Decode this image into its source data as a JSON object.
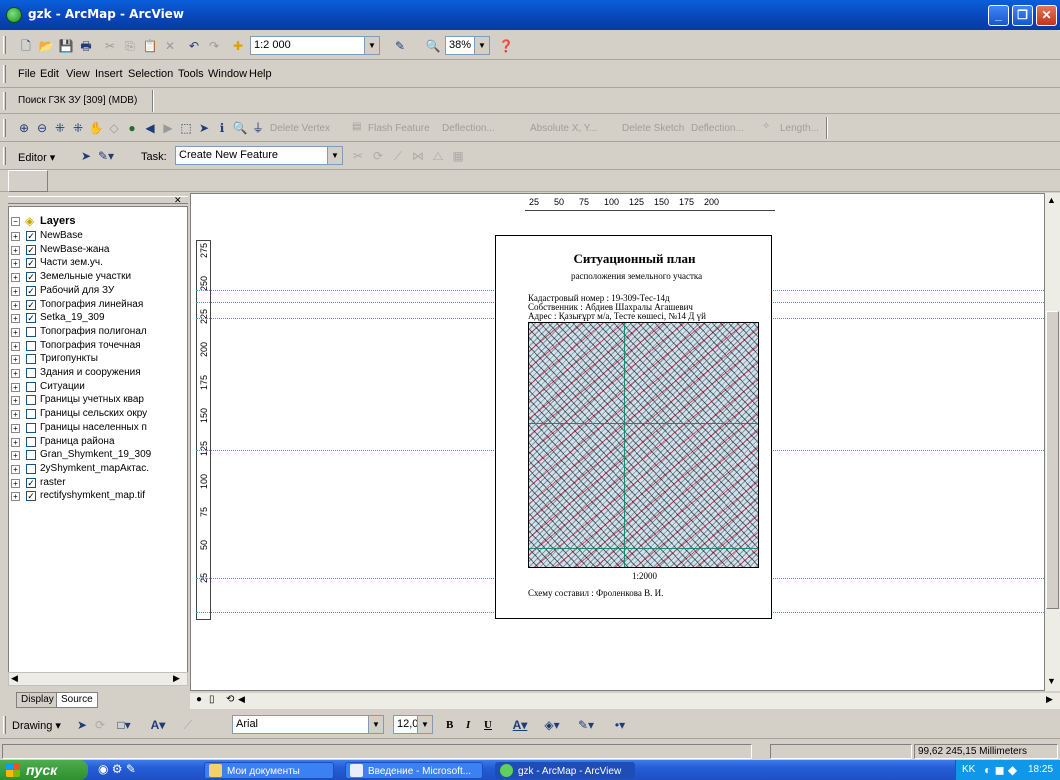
{
  "window": {
    "title": "gzk - ArcMap - ArcView"
  },
  "standard_toolbar": {
    "scale": "1:2 000",
    "zoom": "38%"
  },
  "menu": [
    "File",
    "Edit",
    "View",
    "Insert",
    "Selection",
    "Tools",
    "Window",
    "Help"
  ],
  "search_toolbar": {
    "label": "Поиск  ГЗК  ЗУ [309] (MDB)"
  },
  "tools_toolbar": {
    "buttons": [
      "Delete Vertex",
      "Flash Feature",
      "Deflection...",
      "Absolute X, Y...",
      "Delete Sketch",
      "Deflection...",
      "Length..."
    ]
  },
  "editor_toolbar": {
    "editor_label": "Editor",
    "task_label": "Task:",
    "task_value": "Create New Feature"
  },
  "toc": {
    "root": "Layers",
    "layers": [
      {
        "name": "NewBase",
        "checked": true
      },
      {
        "name": "NewBase-жана",
        "checked": true
      },
      {
        "name": "Части зем.уч.",
        "checked": true
      },
      {
        "name": "Земельные участки",
        "checked": true
      },
      {
        "name": "Рабочий для ЗУ",
        "checked": true
      },
      {
        "name": "Топография линейная",
        "checked": true
      },
      {
        "name": "Setka_19_309",
        "checked": true
      },
      {
        "name": "Топография полигонал",
        "checked": false
      },
      {
        "name": "Топография точечная",
        "checked": false
      },
      {
        "name": "Тригопункты",
        "checked": false
      },
      {
        "name": "Здания и сооружения",
        "checked": false
      },
      {
        "name": "Ситуации",
        "checked": false
      },
      {
        "name": "Границы учетных квар",
        "checked": false
      },
      {
        "name": "Границы сельских окру",
        "checked": false
      },
      {
        "name": "Границы населенных п",
        "checked": false
      },
      {
        "name": "Граница района",
        "checked": false
      },
      {
        "name": "Gran_Shymkent_19_309",
        "checked": false
      },
      {
        "name": "2yShymkent_mapАктас.",
        "checked": false
      },
      {
        "name": "raster",
        "checked": true
      },
      {
        "name": "rectifyshymkent_map.tif",
        "checked": true
      }
    ],
    "tabs": [
      "Display",
      "Source"
    ]
  },
  "ruler_h": [
    "25",
    "50",
    "75",
    "100",
    "125",
    "150",
    "175",
    "200"
  ],
  "ruler_v": [
    "275",
    "250",
    "225",
    "200",
    "175",
    "150",
    "125",
    "100",
    "75",
    "50",
    "25"
  ],
  "layout_page": {
    "title": "Ситуационный план",
    "subtitle": "расположения земельного участка",
    "cadastral": "Кадастровый номер : 19-309-Тес-14д",
    "owner": "Собственник : Абдиев Шахралы Агашевич",
    "address": "Адрес : Қазығұрт м/а, Тесте көшесі, №14 Д үй",
    "scale": "1:2000",
    "author": "Схему составил : Фроленкова В. И."
  },
  "drawing_toolbar": {
    "drawing_label": "Drawing",
    "font": "Arial",
    "size": "12,0",
    "bold": "B",
    "italic": "I",
    "underline": "U"
  },
  "status": {
    "coords": "99,62  245,15 Millimeters"
  },
  "taskbar": {
    "start": "пуск",
    "items": [
      "Мои документы",
      "Введение - Microsoft...",
      "gzk - ArcMap - ArcView"
    ],
    "lang": "KK",
    "clock": "18:25"
  }
}
